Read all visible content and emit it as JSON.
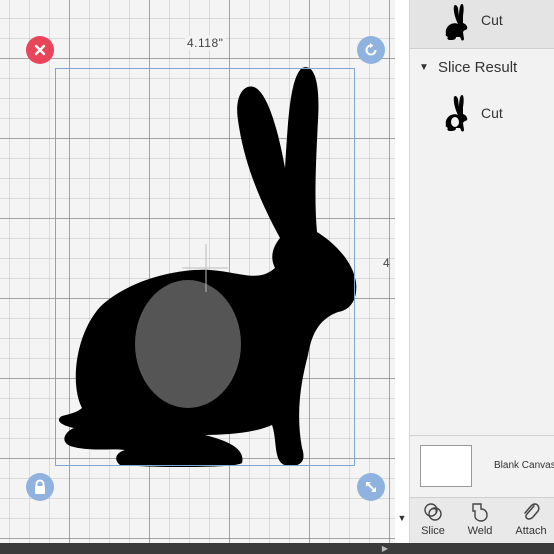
{
  "canvas": {
    "width_dimension": "4.118\"",
    "height_dimension": "4"
  },
  "layers": {
    "top_item": {
      "label": "Cut",
      "icon": "rabbit-silhouette-icon"
    },
    "group": {
      "label": "Slice Result",
      "expanded": true
    },
    "group_item": {
      "label": "Cut",
      "icon": "rabbit-slice-icon"
    }
  },
  "blank_canvas": {
    "label": "Blank Canvas"
  },
  "toolbar": {
    "slice_label": "Slice",
    "weld_label": "Weld",
    "attach_label": "Attach"
  },
  "colors": {
    "delete_handle": "#e8445a",
    "handle": "#8fb3de",
    "selection": "#7ea7d8",
    "shape": "#000000",
    "slice_hole": "#555555"
  }
}
